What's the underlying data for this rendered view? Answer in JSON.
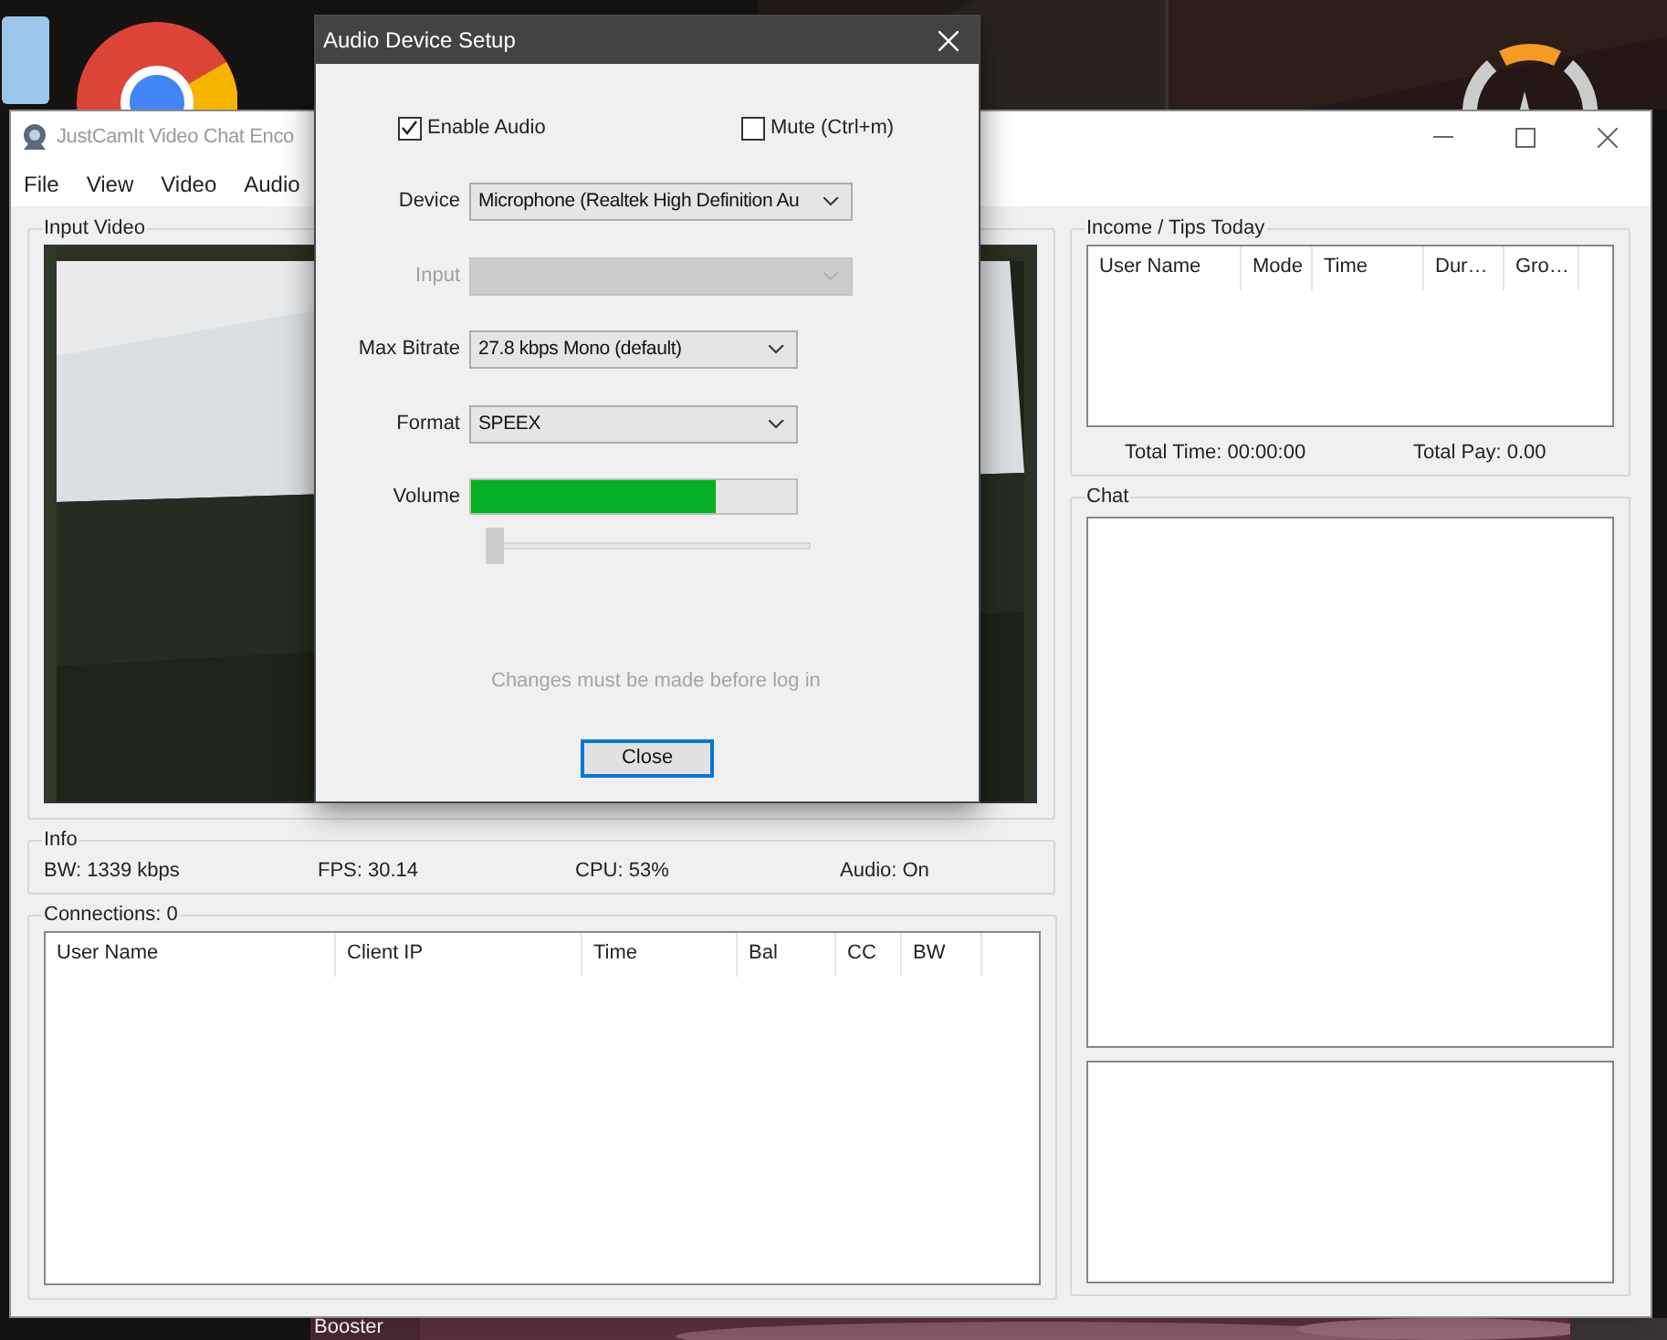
{
  "desktop": {
    "label": "Booster"
  },
  "main_window": {
    "title": "JustCamIt Video Chat Enco",
    "menu": [
      "File",
      "View",
      "Video",
      "Audio"
    ],
    "input_video": {
      "title": "Input Video"
    },
    "info": {
      "title": "Info",
      "items": [
        "BW: 1339 kbps",
        "FPS: 30.14",
        "CPU: 53%",
        "Audio: On"
      ]
    },
    "connections": {
      "title": "Connections: 0",
      "columns": [
        "User Name",
        "Client IP",
        "Time",
        "Bal",
        "CC",
        "BW"
      ]
    },
    "income": {
      "title": "Income / Tips Today",
      "columns": [
        "User Name",
        "Mode",
        "Time",
        "Dur…",
        "Gro…"
      ],
      "total_time": "Total Time: 00:00:00",
      "total_pay": "Total Pay: 0.00"
    },
    "chat": {
      "title": "Chat"
    }
  },
  "dialog": {
    "title": "Audio Device Setup",
    "enable_audio": {
      "label": "Enable Audio",
      "checked": true
    },
    "mute": {
      "label": "Mute (Ctrl+m)",
      "checked": false
    },
    "fields": [
      {
        "label": "Device",
        "value": "Microphone (Realtek High Definition Au",
        "disabled": false
      },
      {
        "label": "Input",
        "disabled": true
      },
      {
        "label": "Max Bitrate",
        "value": "27.8 kbps Mono (default)",
        "disabled": false
      },
      {
        "label": "Format",
        "value": "SPEEX",
        "disabled": false
      }
    ],
    "volume": {
      "label": "Volume",
      "level": 0.75
    },
    "slider": {
      "level": 0
    },
    "note": "Changes must be made before log in",
    "close_button": "Close"
  }
}
